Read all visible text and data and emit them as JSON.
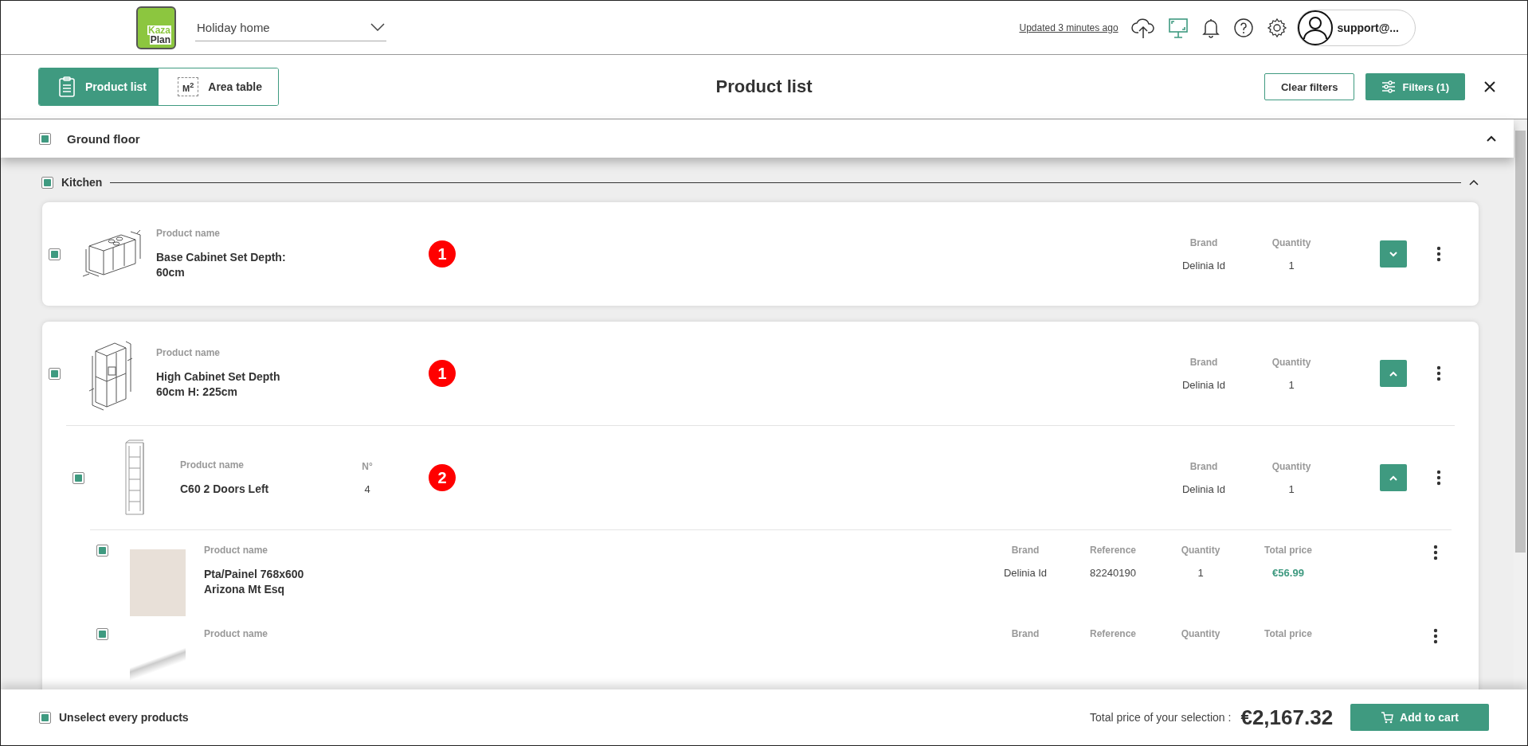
{
  "header": {
    "logo_lines": [
      "Kaza",
      "Plan"
    ],
    "project": "Holiday home",
    "updated": "Updated 3 minutes ago",
    "user": "support@..."
  },
  "toolbar": {
    "tabs": [
      {
        "label": "Product list",
        "selected": true
      },
      {
        "label": "Area table",
        "icon_text": "M$^{2}$",
        "selected": false
      }
    ],
    "title": "Product list",
    "clear_button": "Clear filters",
    "filters_button": "Filters (1)"
  },
  "floors": [
    {
      "name": "Ground floor",
      "checked": true,
      "expanded": true,
      "rooms": [
        {
          "name": "Kitchen",
          "checked": true,
          "expanded": true,
          "products": [
            {
              "kind": "base-cabinet",
              "checked": true,
              "name_label": "Product name",
              "name": "Base Cabinet Set Depth: 60cm",
              "marker": "1",
              "columns": [
                {
                  "label": "Brand",
                  "value": "Delinia Id"
                },
                {
                  "label": "Quantity",
                  "value": "1"
                }
              ],
              "expanded": false
            },
            {
              "kind": "tall-cabinet",
              "checked": true,
              "name_label": "Product name",
              "name": "High Cabinet Set Depth 60cm H: 225cm",
              "marker": "1",
              "columns": [
                {
                  "label": "Brand",
                  "value": "Delinia Id"
                },
                {
                  "label": "Quantity",
                  "value": "1"
                }
              ],
              "expanded": true,
              "children": [
                {
                  "kind": "column-cabinet",
                  "checked": true,
                  "name_label": "Product name",
                  "name": "C60 2 Doors Left",
                  "extra": {
                    "label": "N°",
                    "value": "4"
                  },
                  "marker": "2",
                  "columns": [
                    {
                      "label": "Brand",
                      "value": "Delinia Id"
                    },
                    {
                      "label": "Quantity",
                      "value": "1"
                    }
                  ],
                  "expanded": true,
                  "children": [
                    {
                      "kind": "panel-photo",
                      "checked": true,
                      "name_label": "Product name",
                      "name": "Pta/Painel 768x600 Arizona Mt Esq",
                      "columns": [
                        {
                          "label": "Brand",
                          "value": "Delinia Id"
                        },
                        {
                          "label": "Reference",
                          "value": "82240190"
                        },
                        {
                          "label": "Quantity",
                          "value": "1"
                        },
                        {
                          "label": "Total price",
                          "value": "€56.99",
                          "kind": "price"
                        }
                      ]
                    },
                    {
                      "kind": "handle-photo",
                      "checked": true,
                      "name_label": "Product name",
                      "columns": [
                        {
                          "label": "Brand"
                        },
                        {
                          "label": "Reference"
                        },
                        {
                          "label": "Quantity"
                        },
                        {
                          "label": "Total price"
                        }
                      ]
                    }
                  ]
                }
              ]
            }
          ]
        }
      ]
    }
  ],
  "footer": {
    "unselect_checked": true,
    "unselect_label": "Unselect every products",
    "total_label": "Total price of your selection :",
    "total": "€2,167.32",
    "cart_button": "Add to cart"
  }
}
